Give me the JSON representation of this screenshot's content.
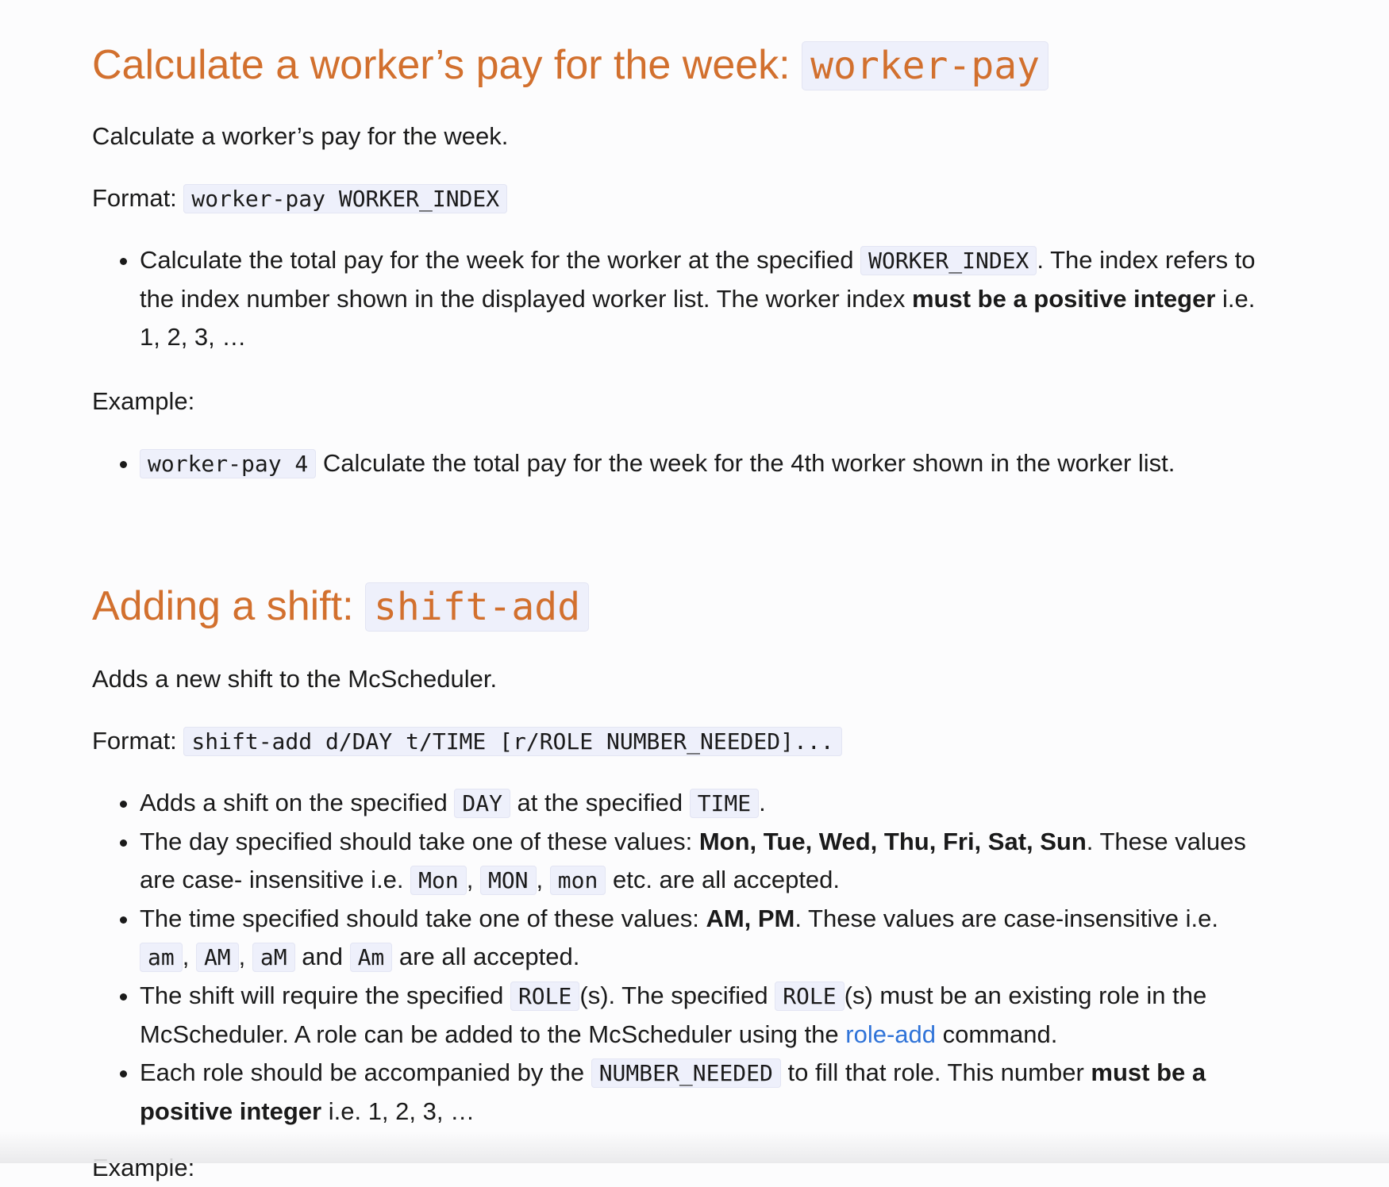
{
  "worker_pay": {
    "title": "Calculate a worker’s pay for the week: ",
    "command": "worker-pay",
    "description": "Calculate a worker’s pay for the week.",
    "format_label": "Format: ",
    "format_code": "worker-pay WORKER_INDEX",
    "bullet1": {
      "text1": "Calculate the total pay for the week for the worker at the specified ",
      "code": "WORKER_INDEX",
      "text2": ". The index refers to the index number shown in the displayed worker list. The worker index ",
      "bold": "must be a positive integer",
      "text3": " i.e. 1, 2, 3, …"
    },
    "example_label": "Example:",
    "example": {
      "code": "worker-pay 4",
      "text": " Calculate the total pay for the week for the 4th worker shown in the worker list."
    }
  },
  "shift_add": {
    "title": "Adding a shift: ",
    "command": "shift-add",
    "description": "Adds a new shift to the McScheduler.",
    "format_label": "Format: ",
    "format_code": "shift-add d/DAY t/TIME [r/ROLE NUMBER_NEEDED]...",
    "b1": {
      "text1": "Adds a shift on the specified ",
      "code1": "DAY",
      "text2": " at the specified ",
      "code2": "TIME",
      "text3": "."
    },
    "b2": {
      "text1": "The day specified should take one of these values: ",
      "bold": "Mon, Tue, Wed, Thu, Fri, Sat, Sun",
      "text2": ". These values are case- insensitive i.e. ",
      "code1": "Mon",
      "sep1": ", ",
      "code2": "MON",
      "sep2": ", ",
      "code3": "mon",
      "text3": " etc. are all accepted."
    },
    "b3": {
      "text1": "The time specified should take one of these values: ",
      "bold": "AM, PM",
      "text2": ". These values are case-insensitive i.e. ",
      "code1": "am",
      "sep1": ", ",
      "code2": "AM",
      "sep2": ", ",
      "code3": "aM",
      "sep3": " and ",
      "code4": "Am",
      "text3": " are all accepted."
    },
    "b4": {
      "text1": "The shift will require the specified ",
      "code1": "ROLE",
      "text2": "(s). The specified ",
      "code2": "ROLE",
      "text3": "(s) must be an existing role in the McScheduler. A role can be added to the McScheduler using the ",
      "link": "role-add",
      "text4": " command."
    },
    "b5": {
      "text1": "Each role should be accompanied by the ",
      "code": "NUMBER_NEEDED",
      "text2": " to fill that role. This number ",
      "bold": "must be a positive integer",
      "text3": " i.e. 1, 2, 3, …"
    },
    "next_label": "Example:"
  }
}
